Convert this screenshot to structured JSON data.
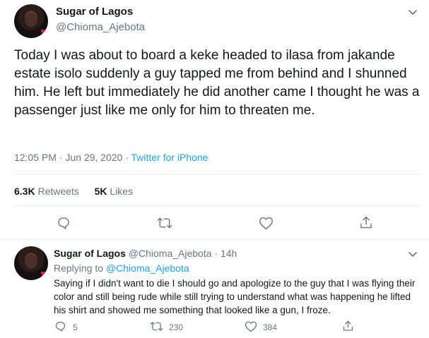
{
  "main_tweet": {
    "display_name": "Sugar of Lagos",
    "handle": "@Chioma_Ajebota",
    "text": "Today I was about to board a keke headed to ilasa from jakande estate isolo suddenly a guy tapped me from behind and I shunned him. He left but immediately he did another came I thought he was a passenger just like me only for him to threaten me.",
    "time": "12:05 PM · Jun 29, 2020",
    "separator": " · ",
    "source": "Twitter for iPhone",
    "retweets_count": "6.3K",
    "retweets_label": "Retweets",
    "likes_count": "5K",
    "likes_label": "Likes"
  },
  "reply_tweet": {
    "display_name": "Sugar of Lagos",
    "handle_time": "@Chioma_Ajebota · 14h",
    "replying_prefix": "Replying to ",
    "replying_to": "@Chioma_Ajebota",
    "text": "Saying if I didn't want to die I should go and apologize to the guy that I was flying their color and still being rude while still trying to understand what was happening he lifted his shirt and showed me something that looked like a gun, I froze.",
    "reply_count": "5",
    "retweet_count": "230",
    "like_count": "384"
  },
  "icons": {
    "avatar": "avatar-photo",
    "menu": "chevron-down-icon",
    "reply": "reply-icon",
    "retweet": "retweet-icon",
    "like": "heart-icon",
    "share": "share-icon"
  },
  "colors": {
    "text": "#14171a",
    "secondary": "#657786",
    "link": "#1da1f2",
    "divider": "#e6ecf0"
  }
}
